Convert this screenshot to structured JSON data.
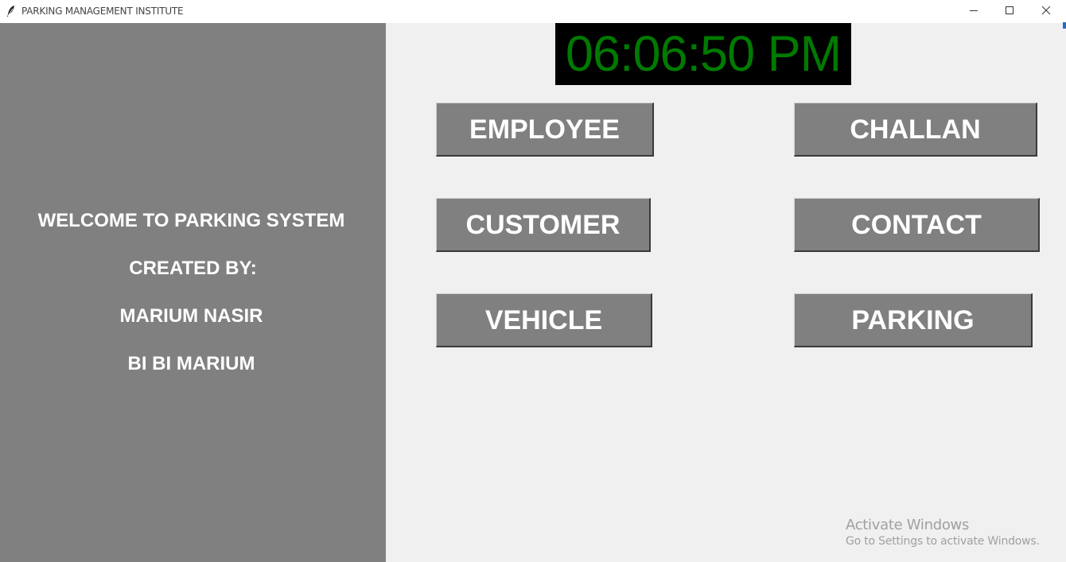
{
  "window": {
    "title": "PARKING MANAGEMENT INSTITUTE",
    "app_icon": "feather-icon",
    "controls": [
      "minimize-icon",
      "maximize-icon",
      "close-icon"
    ]
  },
  "left_panel": {
    "welcome": "WELCOME TO PARKING SYSTEM",
    "created_by": "CREATED BY:",
    "author1": "MARIUM NASIR",
    "author2": "BI BI MARIUM"
  },
  "clock": {
    "time": "06:06:50 PM"
  },
  "buttons": {
    "employee": "EMPLOYEE",
    "customer": "CUSTOMER",
    "vehicle": "VEHICLE",
    "challan": "CHALLAN",
    "contact": "CONTACT",
    "parking": "PARKING"
  },
  "watermark": {
    "line1": "Activate Windows",
    "line2": "Go to Settings to activate Windows."
  },
  "colors": {
    "panel": "#808080",
    "clock_bg": "#000000",
    "clock_text": "#007a00",
    "background": "#f0f0f0"
  }
}
